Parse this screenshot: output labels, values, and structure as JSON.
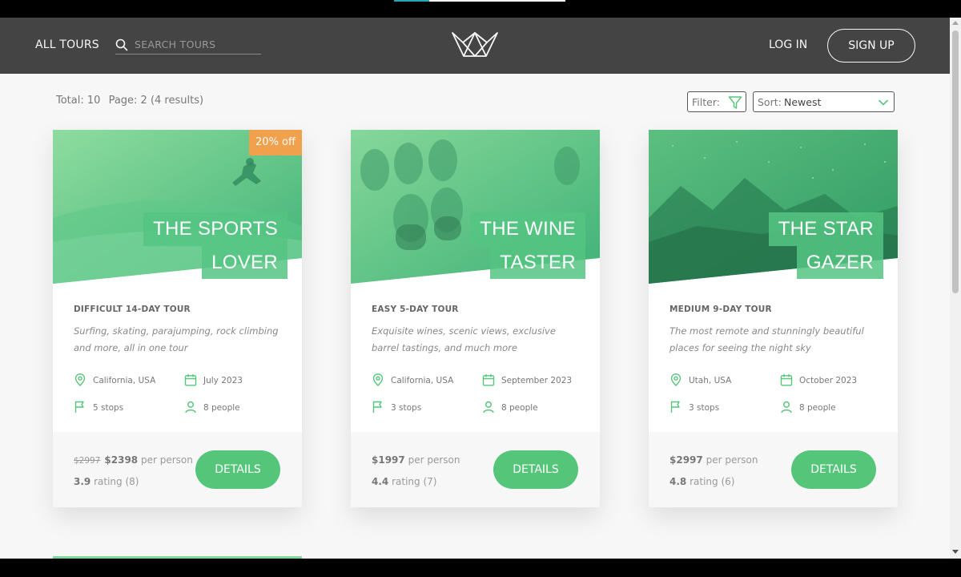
{
  "header": {
    "all_tours": "ALL TOURS",
    "search_placeholder": "SEARCH TOURS",
    "login": "LOG IN",
    "signup": "SIGN UP"
  },
  "toolbar": {
    "total": "Total: 10",
    "page": "Page: 2 (4 results)",
    "filter_label": "Filter:",
    "sort_label": "Sort:",
    "sort_value": "Newest"
  },
  "cards": [
    {
      "badge": "20% off",
      "title_line1": "THE SPORTS",
      "title_line2": "LOVER",
      "subtitle": "DIFFICULT 14-DAY TOUR",
      "description": "Surfing, skating, parajumping, rock climbing and more, all in one tour",
      "location": "California, USA",
      "date": "July 2023",
      "stops": "5 stops",
      "people": "8 people",
      "old_price": "$2997",
      "price": "$2398",
      "per_person": "per person",
      "rating": "3.9",
      "rating_label": "rating",
      "rating_count": "(8)",
      "details": "DETAILS"
    },
    {
      "title_line1": "THE WINE",
      "title_line2": "TASTER",
      "subtitle": "EASY 5-DAY TOUR",
      "description": "Exquisite wines, scenic views, exclusive barrel tastings, and much more",
      "location": "California, USA",
      "date": "September 2023",
      "stops": "3 stops",
      "people": "8 people",
      "price": "$1997",
      "per_person": "per person",
      "rating": "4.4",
      "rating_label": "rating",
      "rating_count": "(7)",
      "details": "DETAILS"
    },
    {
      "title_line1": "THE STAR",
      "title_line2": "GAZER",
      "subtitle": "MEDIUM 9-DAY TOUR",
      "description": "The most remote and stunningly beautiful places for seeing the night sky",
      "location": "Utah, USA",
      "date": "October 2023",
      "stops": "3 stops",
      "people": "8 people",
      "price": "$2997",
      "per_person": "per person",
      "rating": "4.8",
      "rating_label": "rating",
      "rating_count": "(6)",
      "details": "DETAILS"
    }
  ],
  "colors": {
    "header_bg": "#444444",
    "accent_green": "#55c57a",
    "badge_orange": "#f1a04c",
    "page_bg": "#f7f7f7"
  },
  "icons": [
    "search-icon",
    "crown-logo-icon",
    "filter-funnel-icon",
    "chevron-down-icon",
    "map-pin-icon",
    "calendar-icon",
    "flag-icon",
    "user-icon"
  ]
}
